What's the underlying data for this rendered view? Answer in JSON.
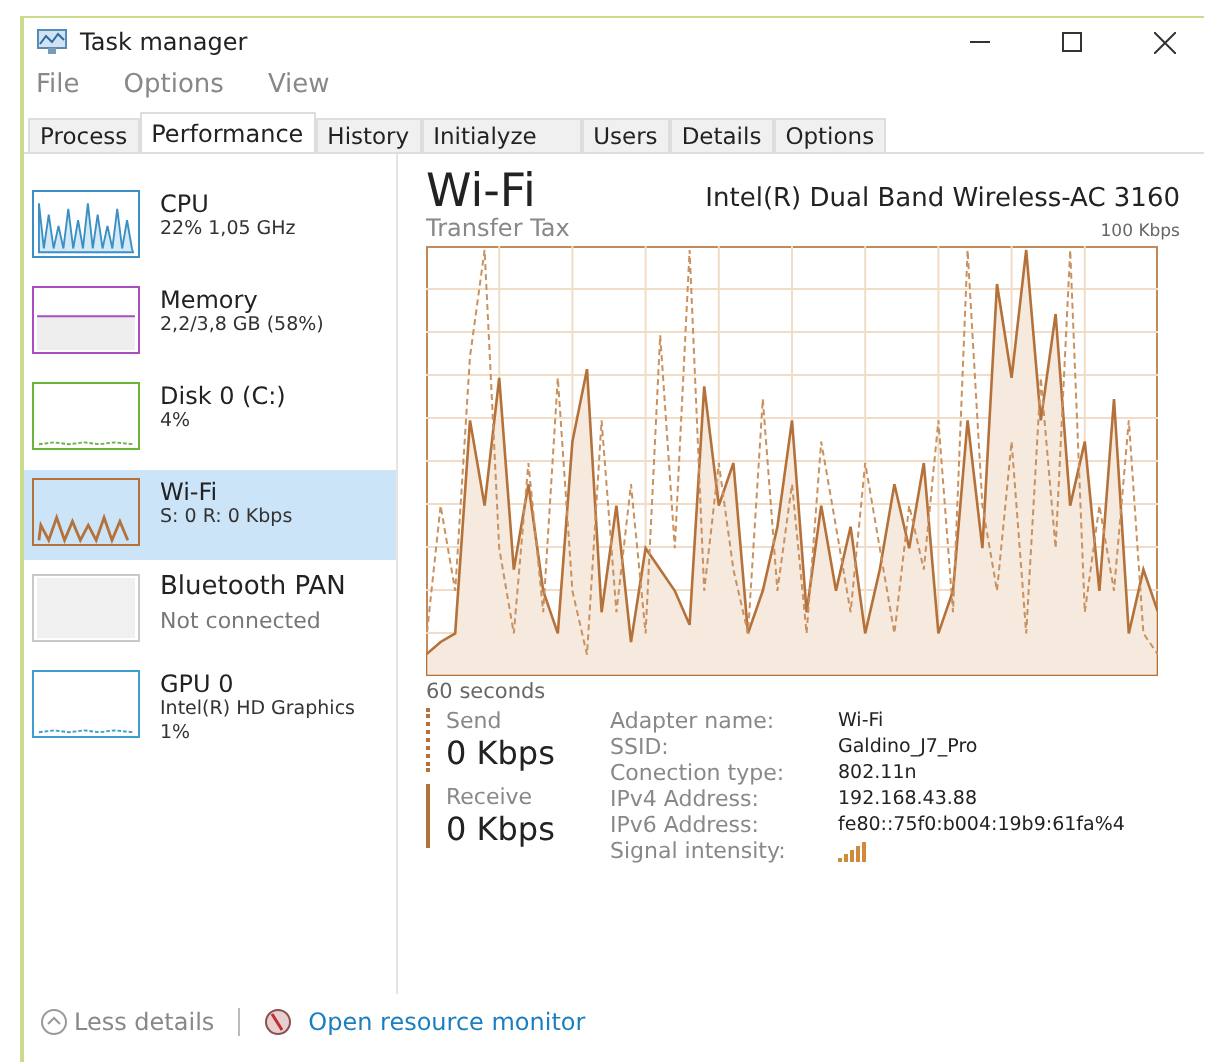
{
  "window": {
    "title": "Task manager"
  },
  "menu": [
    "File",
    "Options",
    "View"
  ],
  "tabs": [
    {
      "label": "Process",
      "selected": false
    },
    {
      "label": "Performance",
      "selected": true
    },
    {
      "label": "History",
      "selected": false
    },
    {
      "label": "Initialyze",
      "selected": false
    },
    {
      "label": "Users",
      "selected": false
    },
    {
      "label": "Details",
      "selected": false
    },
    {
      "label": "Options",
      "selected": false
    }
  ],
  "sidebar": {
    "items": [
      {
        "name": "CPU",
        "detail": "22% 1,05 GHz",
        "color": "#3c8fc4",
        "kind": "cpu",
        "selected": false
      },
      {
        "name": "Memory",
        "detail": "2,2/3,8 GB (58%)",
        "color": "#a84fc0",
        "kind": "memory",
        "selected": false
      },
      {
        "name": "Disk 0 (C:)",
        "detail": "4%",
        "color": "#6cb33e",
        "kind": "flat",
        "selected": false
      },
      {
        "name": "Wi-Fi",
        "detail": "S: 0 R: 0 Kbps",
        "color": "#b5713a",
        "kind": "spikes",
        "selected": true
      },
      {
        "name": "Bluetooth PAN",
        "detail": "Not connected",
        "color": "#c8c8c8",
        "kind": "empty",
        "selected": false
      },
      {
        "name": "GPU 0",
        "detail": "Intel(R) HD Graphics",
        "detail2": "1%",
        "color": "#3c9fd0",
        "kind": "flat",
        "selected": false
      }
    ]
  },
  "panel": {
    "title": "Wi-Fi",
    "device": "Intel(R) Dual Band Wireless-AC 3160",
    "graph_label": "Transfer Tax",
    "graph_max": "100 Kbps",
    "time_span": "60 seconds",
    "send": {
      "label": "Send",
      "value": "0 Kbps"
    },
    "receive": {
      "label": "Receive",
      "value": "0 Kbps"
    },
    "properties": [
      {
        "label": "Adapter name:",
        "value": "Wi-Fi"
      },
      {
        "label": "SSID:",
        "value": "Galdino_J7_Pro"
      },
      {
        "label": "Conection type:",
        "value": "802.11n"
      },
      {
        "label": "IPv4 Address:",
        "value": "192.168.43.88"
      },
      {
        "label": "IPv6 Address:",
        "value": "fe80::75f0:b004:19b9:61fa%4"
      },
      {
        "label": "Signal intensity:",
        "kind": "signal"
      }
    ]
  },
  "footer": {
    "less_details": "Less details",
    "resource_monitor": "Open resource monitor"
  }
}
